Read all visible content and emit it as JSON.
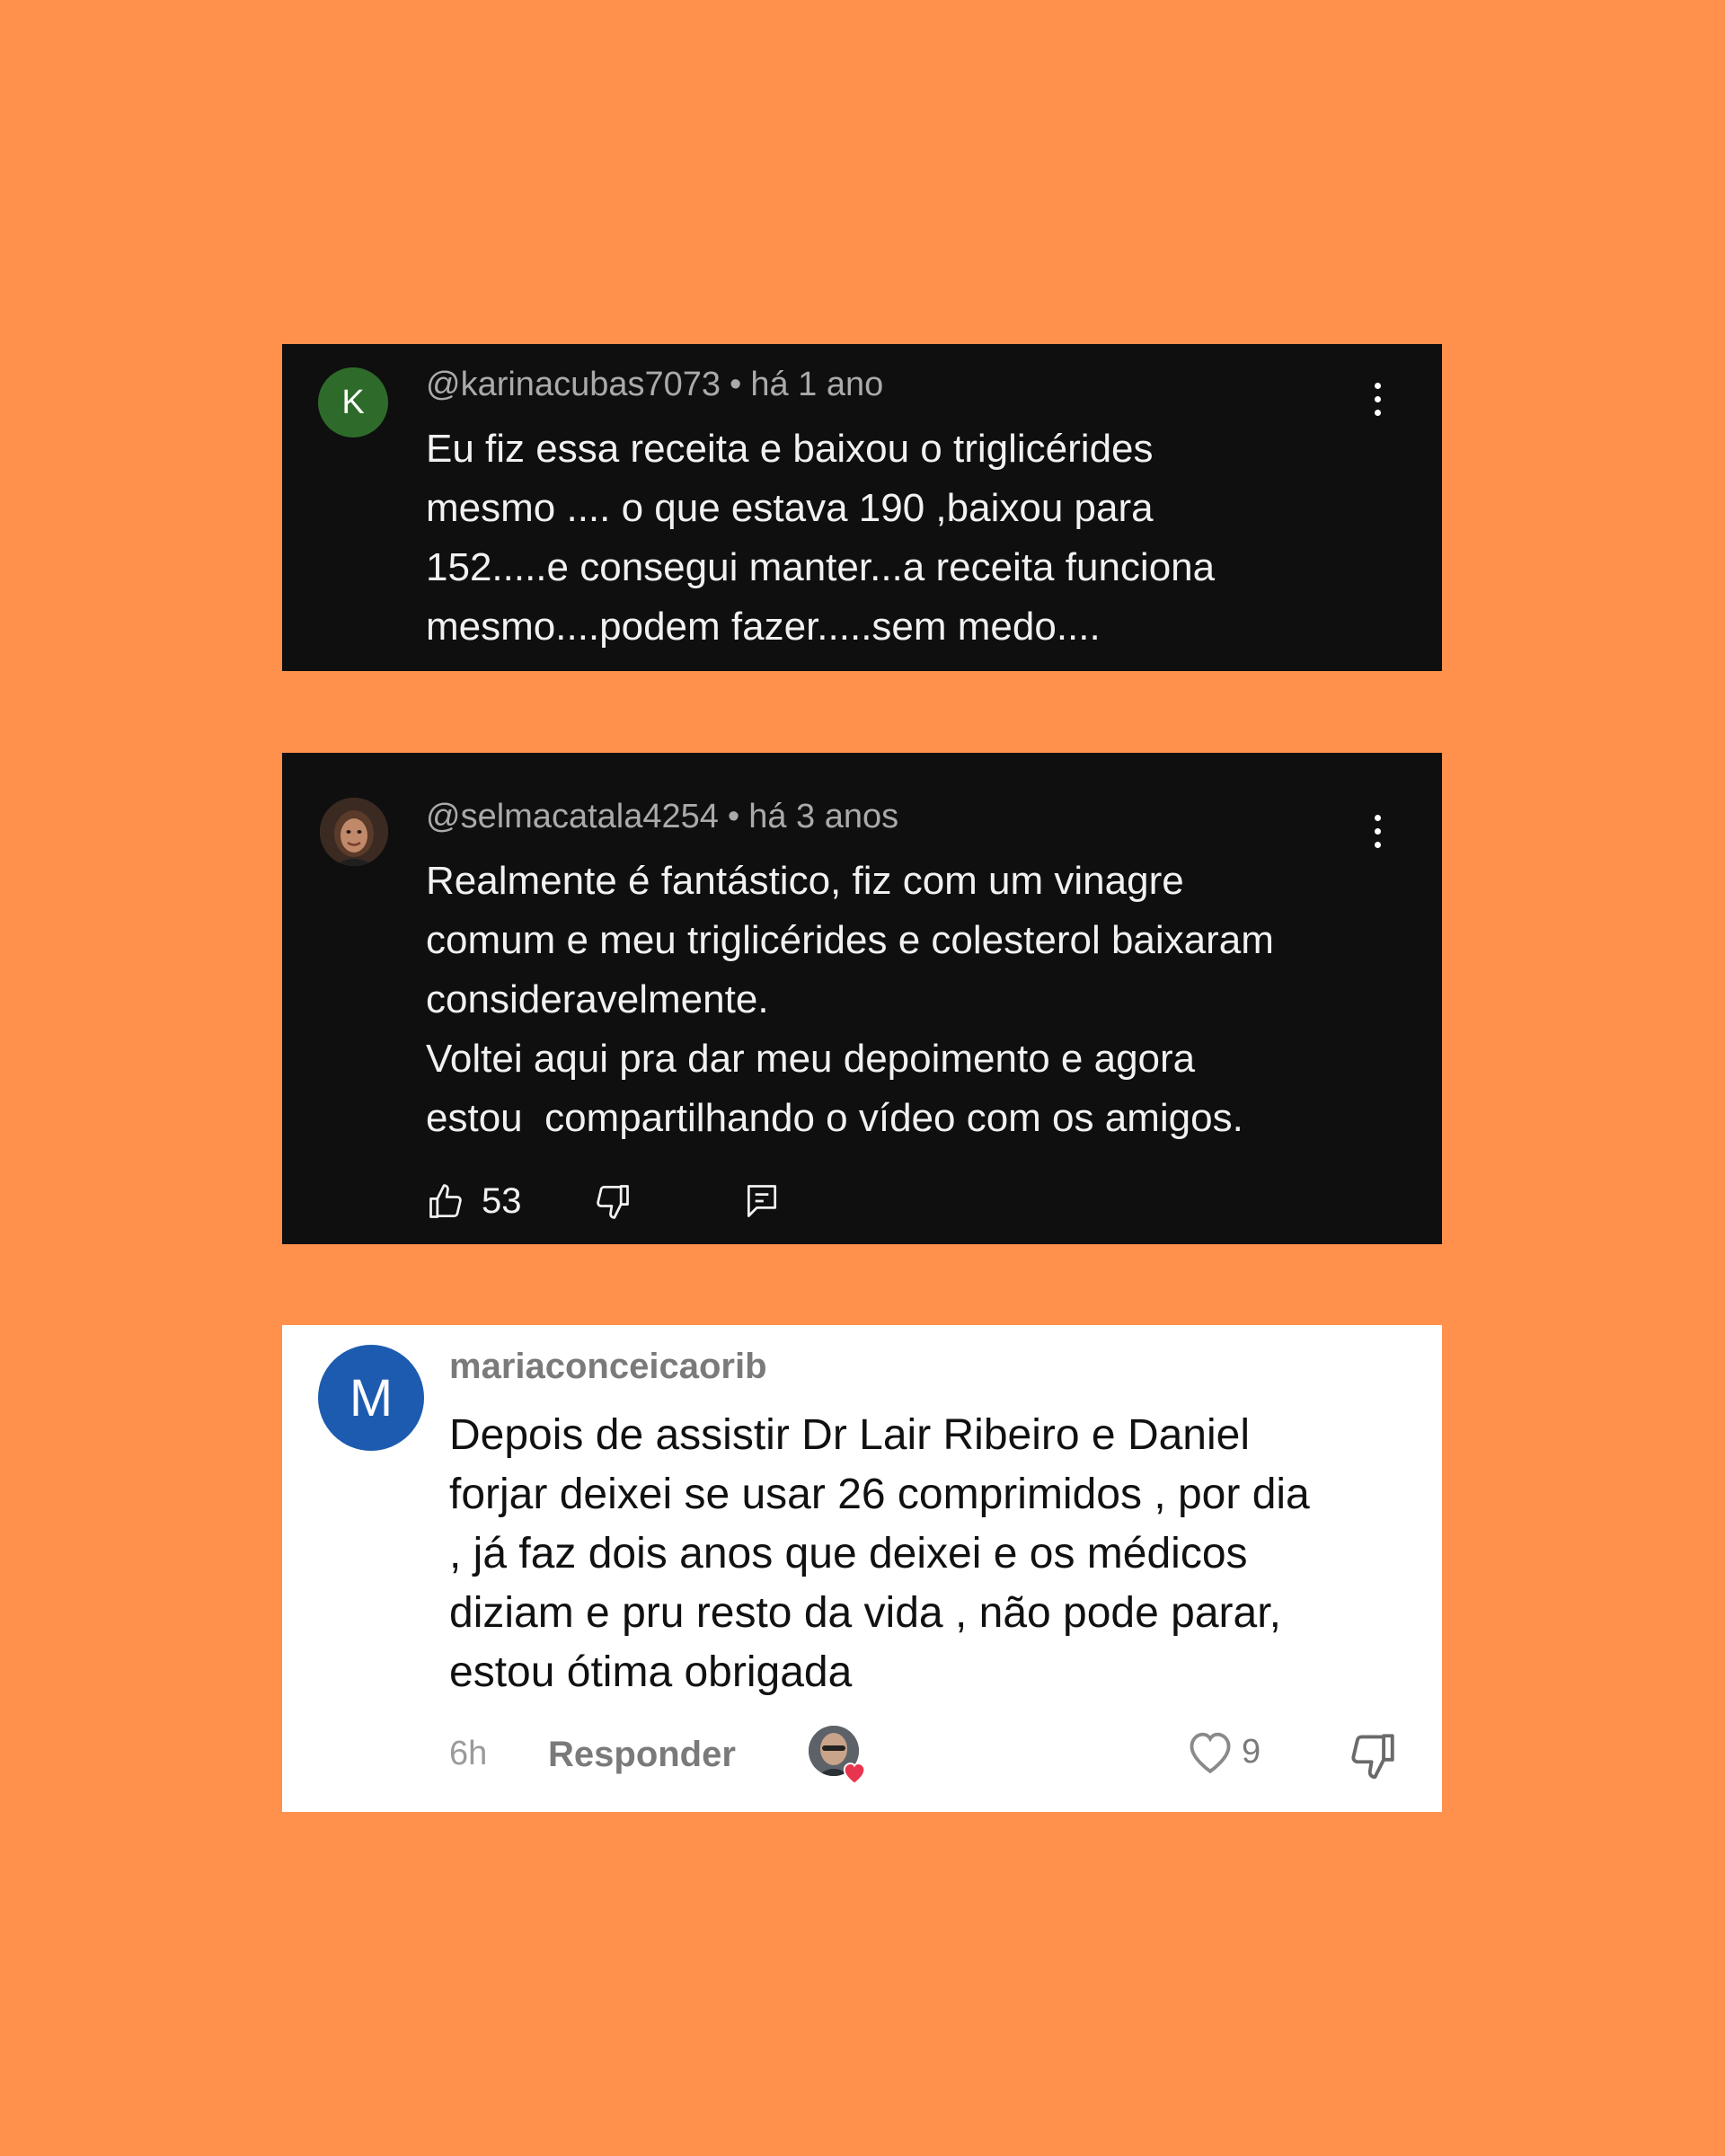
{
  "comments": [
    {
      "avatar_letter": "K",
      "avatar_color": "#2e6b2a",
      "username": "@karinacubas7073",
      "separator": "•",
      "time": "há 1 ano",
      "text": "Eu fiz essa receita e baixou o triglicérides\nmesmo .... o que estava 190 ,baixou para\n152.....e consegui manter...a receita funciona\nmesmo....podem fazer.....sem medo...."
    },
    {
      "avatar_icon": "profile-photo",
      "username": "@selmacatala4254",
      "separator": "•",
      "time": "há 3 anos",
      "text": "Realmente é fantástico, fiz com um vinagre\ncomum e meu triglicérides e colesterol baixaram\nconsideravelmente.\nVoltei aqui pra dar meu depoimento e agora\nestou  compartilhando o vídeo com os amigos.",
      "likes": "53"
    },
    {
      "avatar_letter": "M",
      "avatar_color": "#1c5bb0",
      "username": "mariaconceicaorib",
      "text": "Depois de assistir Dr Lair Ribeiro e Daniel\nforjar deixei se usar 26 comprimidos , por dia\n, já faz dois anos que deixei e os médicos\ndiziam e pru resto da vida , não pode parar,\nestou ótima obrigada",
      "time": "6h",
      "reply_label": "Responder",
      "likes": "9"
    }
  ],
  "colors": {
    "background": "#FF914D",
    "dark_card": "#0f0f0f",
    "light_card": "#ffffff",
    "heart_badge": "#e8344e"
  }
}
